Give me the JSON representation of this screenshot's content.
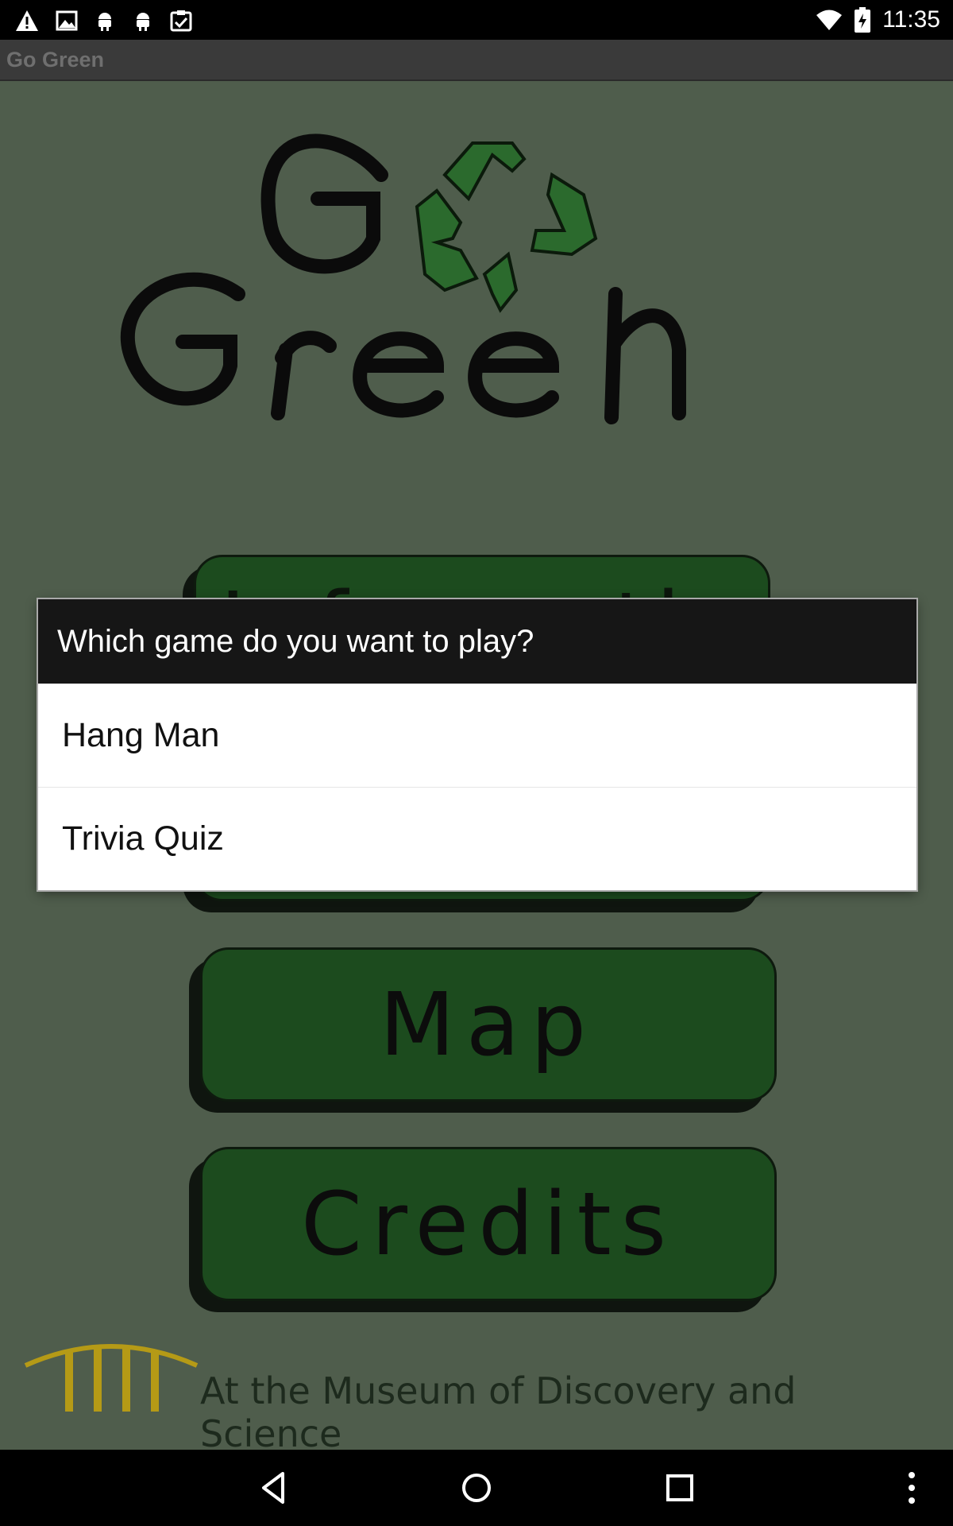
{
  "status_bar": {
    "time": "11:35",
    "left_icons": [
      "warning-icon",
      "image-icon",
      "android-icon",
      "android-icon",
      "clipboard-check-icon"
    ],
    "right_icons": [
      "wifi-icon",
      "battery-charging-icon"
    ]
  },
  "app_bar": {
    "title": "Go Green"
  },
  "logo": {
    "line1": "Go",
    "line2": "Green"
  },
  "menu": {
    "info_label": "Information",
    "map_label": "Map",
    "credits_label": "Credits"
  },
  "footer": {
    "museum_text": "At the Museum of Discovery and Science"
  },
  "dialog": {
    "title": "Which game do you want to play?",
    "options": [
      {
        "label": "Hang Man"
      },
      {
        "label": "Trivia Quiz"
      }
    ]
  },
  "colors": {
    "background": "#4f5d4c",
    "button_green": "#1c4b1e",
    "recycle_green": "#2b6a2d",
    "dialog_header": "#161616",
    "museum_gold": "#b59a16"
  },
  "nav_bar": {
    "buttons": [
      "back-icon",
      "home-icon",
      "recents-icon",
      "overflow-icon"
    ]
  }
}
